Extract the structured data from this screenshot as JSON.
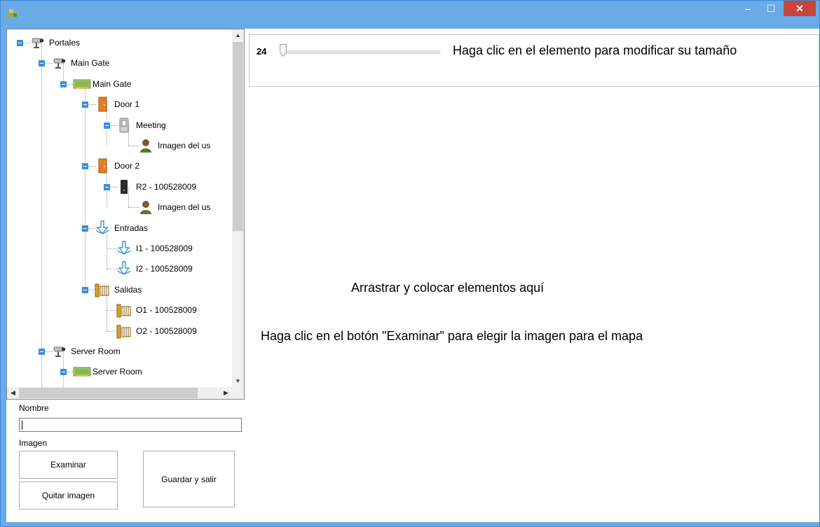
{
  "window": {
    "minimize": "–",
    "maximize": "☐",
    "close": "✕"
  },
  "tree": {
    "items": [
      {
        "label": "Portales",
        "icon": "camera-icon"
      },
      {
        "label": "Main Gate",
        "icon": "camera-icon"
      },
      {
        "label": "Main Gate",
        "icon": "controller-board-icon"
      },
      {
        "label": "Door 1",
        "icon": "door-icon"
      },
      {
        "label": "Meeting",
        "icon": "card-reader-icon"
      },
      {
        "label": "Imagen del us",
        "icon": "user-icon"
      },
      {
        "label": "Door 2",
        "icon": "door-icon"
      },
      {
        "label": "R2 - 100528009",
        "icon": "reader-black-icon"
      },
      {
        "label": "Imagen del us",
        "icon": "user-icon"
      },
      {
        "label": "Entradas",
        "icon": "input-arrow-icon"
      },
      {
        "label": "I1 - 100528009",
        "icon": "input-arrow-icon"
      },
      {
        "label": "I2 - 100528009",
        "icon": "input-arrow-icon"
      },
      {
        "label": "Salidas",
        "icon": "output-gate-icon"
      },
      {
        "label": "O1 - 100528009",
        "icon": "output-gate-icon"
      },
      {
        "label": "O2 - 100528009",
        "icon": "output-gate-icon"
      },
      {
        "label": "Server Room",
        "icon": "camera-icon"
      },
      {
        "label": "Server Room",
        "icon": "controller-board-icon"
      }
    ]
  },
  "form": {
    "name_label": "Nombre",
    "name_value": "",
    "image_label": "Imagen",
    "browse_button": "Examinar",
    "remove_image_button": "Quitar imagen",
    "save_exit_button": "Guardar y salir"
  },
  "toolbar": {
    "size_value": "24",
    "size_slider_fraction": 0,
    "hint": "Haga clic en el elemento para modificar su tamaño"
  },
  "canvas": {
    "drop_text": "Arrastrar y colocar elementos aquí",
    "browse_hint": "Haga clic en el botón \"Examinar\" para elegir la imagen para el mapa"
  }
}
